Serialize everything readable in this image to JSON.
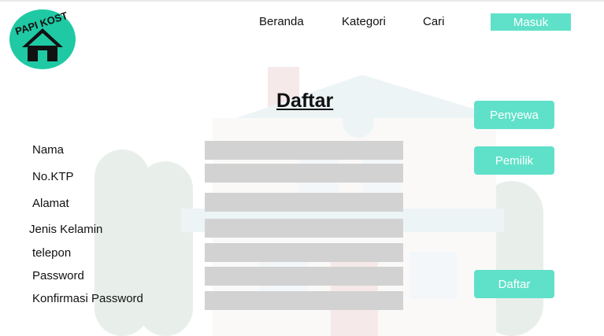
{
  "brand": {
    "logo_text": "PAPI KOST",
    "logo_icon": "house-icon"
  },
  "nav": {
    "home": "Beranda",
    "category": "Kategori",
    "search": "Cari",
    "login": "Masuk"
  },
  "form": {
    "title": "Daftar",
    "fields": [
      {
        "label": "Nama",
        "value": ""
      },
      {
        "label": "No.KTP",
        "value": ""
      },
      {
        "label": "Alamat",
        "value": ""
      },
      {
        "label": "Jenis Kelamin",
        "value": ""
      },
      {
        "label": "telepon",
        "value": ""
      },
      {
        "label": "Password",
        "value": ""
      },
      {
        "label": "Konfirmasi Password",
        "value": ""
      }
    ],
    "role_tenant": "Penyewa",
    "role_owner": "Pemilik",
    "submit": "Daftar"
  },
  "colors": {
    "accent": "#5fe1c9",
    "field_bg": "#d2d2d2",
    "logo_bg": "#1fc9a4"
  }
}
